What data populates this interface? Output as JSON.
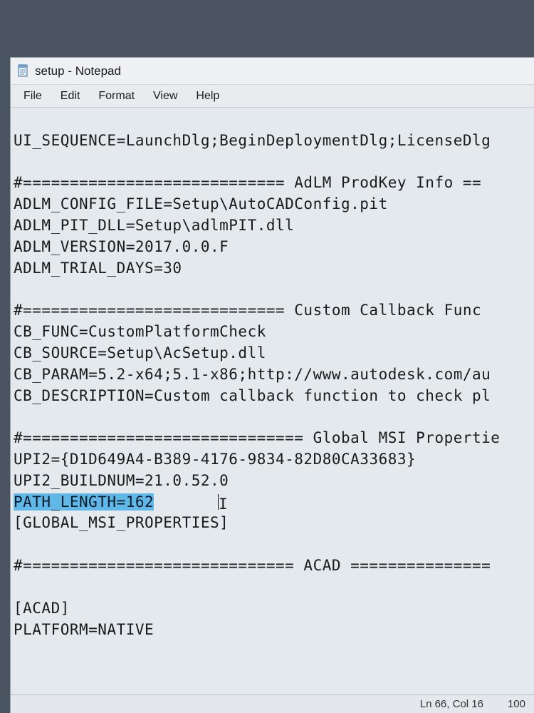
{
  "window": {
    "title": "setup - Notepad"
  },
  "menu": {
    "file": "File",
    "edit": "Edit",
    "format": "Format",
    "view": "View",
    "help": "Help"
  },
  "content": {
    "l01": "UI_SEQUENCE=LaunchDlg;BeginDeploymentDlg;LicenseDlg",
    "l02": "",
    "l03": "#============================ AdLM ProdKey Info ==",
    "l04": "ADLM_CONFIG_FILE=Setup\\AutoCADConfig.pit",
    "l05": "ADLM_PIT_DLL=Setup\\adlmPIT.dll",
    "l06": "ADLM_VERSION=2017.0.0.F",
    "l07": "ADLM_TRIAL_DAYS=30",
    "l08": "",
    "l09": "#============================ Custom Callback Func",
    "l10": "CB_FUNC=CustomPlatformCheck",
    "l11": "CB_SOURCE=Setup\\AcSetup.dll",
    "l12": "CB_PARAM=5.2-x64;5.1-x86;http://www.autodesk.com/au",
    "l13": "CB_DESCRIPTION=Custom callback function to check pl",
    "l14": "",
    "l15": "#============================== Global MSI Propertie",
    "l16": "UPI2={D1D649A4-B389-4176-9834-82D80CA33683}",
    "l17": "UPI2_BUILDNUM=21.0.52.0",
    "l18_sel": "PATH_LENGTH=162",
    "l19": "[GLOBAL_MSI_PROPERTIES]",
    "l20": "",
    "l21": "#============================= ACAD ===============",
    "l22": "",
    "l23": "[ACAD]",
    "l24": "PLATFORM=NATIVE"
  },
  "status": {
    "pos": "Ln 66, Col 16",
    "zoom": "100"
  }
}
